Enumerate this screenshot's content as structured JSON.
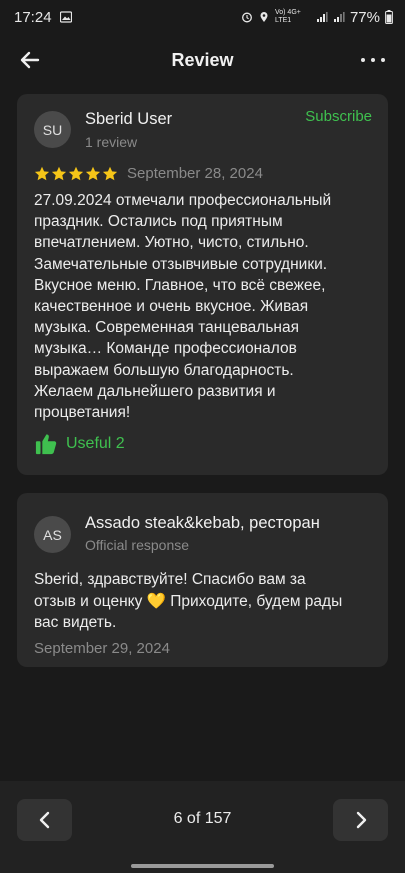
{
  "status_bar": {
    "time": "17:24",
    "network_label": "Vo) 4G+ LTE1",
    "battery": "77%"
  },
  "header": {
    "title": "Review"
  },
  "review": {
    "avatar_initials": "SU",
    "author": "Sberid User",
    "review_count": "1 review",
    "subscribe_label": "Subscribe",
    "rating": 5,
    "date": "September 28, 2024",
    "text_lines": [
      "27.09.2024 отмечали профессиональный",
      "праздник. Остались под приятным",
      "впечатлением. Уютно, чисто, стильно.",
      "Замечательные отзывчивые сотрудники.",
      "Вкусное меню. Главное, что всё свежее,",
      "качественное и очень вкусное. Живая",
      "музыка. Современная танцевальная",
      "музыка… Команде профессионалов",
      "выражаем большую благодарность.",
      "Желаем дальнейшего развития и",
      "процветания!"
    ],
    "useful_label": "Useful 2"
  },
  "response": {
    "avatar_initials": "AS",
    "author": "Assado steak&kebab, ресторан",
    "label": "Official response",
    "text_lines": [
      "Sberid, здравствуйте! Спасибо вам за",
      "отзыв и оценку 💛 Приходите, будем рады",
      "вас видеть."
    ],
    "date": "September 29, 2024"
  },
  "pager": {
    "label": "6 of 157"
  },
  "colors": {
    "accent_green": "#3fc04f",
    "star_yellow": "#f5c518",
    "background": "#1a1a1a",
    "card": "#2a2a2a"
  }
}
